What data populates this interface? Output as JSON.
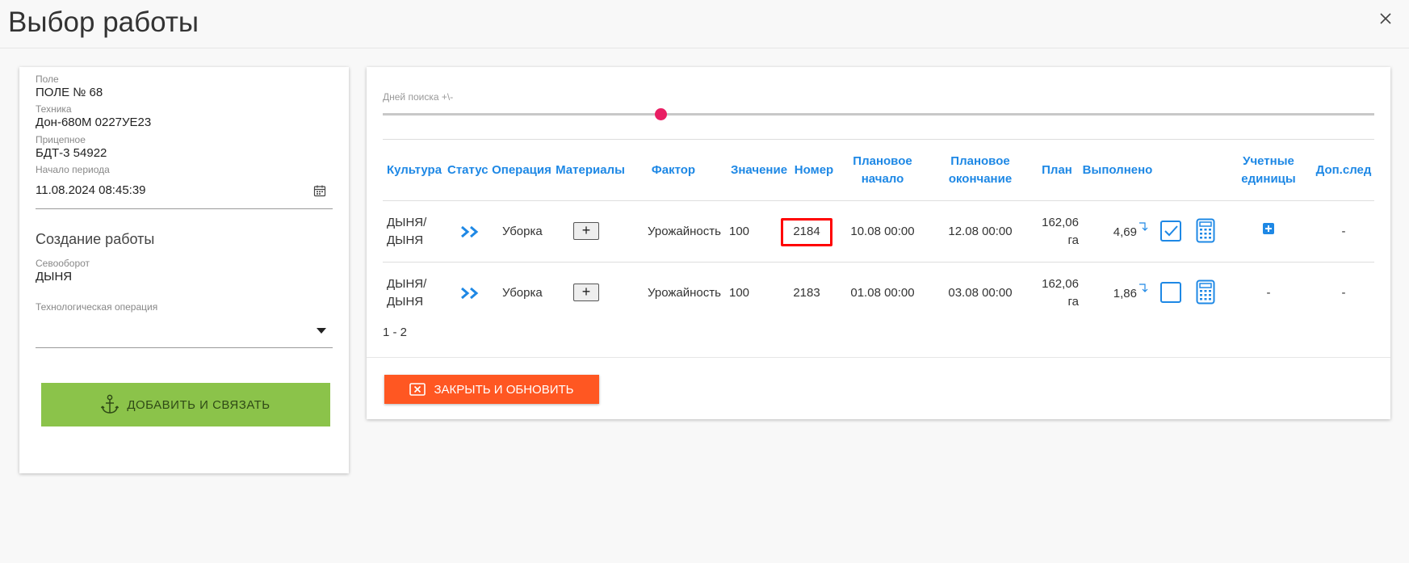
{
  "dialog": {
    "title": "Выбор работы"
  },
  "left": {
    "field_label": "Поле",
    "field_value": "ПОЛЕ № 68",
    "machine_label": "Техника",
    "machine_value": "Дон-680М 0227УЕ23",
    "trailer_label": "Прицепное",
    "trailer_value": "БДТ-3 54922",
    "period_label": "Начало периода",
    "period_value": "11.08.2024 08:45:39",
    "create_title": "Создание работы",
    "rotation_label": "Севооборот",
    "rotation_value": "ДЫНЯ",
    "techop_label": "Технологическая операция",
    "add_button": "ДОБАВИТЬ И СВЯЗАТЬ"
  },
  "right": {
    "slider_label": "Дней поиска +\\-",
    "slider_value_fraction": 0.28,
    "columns": [
      "Культура",
      "Статус",
      "Операция",
      "Материалы",
      "Фактор",
      "Значение",
      "Номер",
      "Плановое начало",
      "Плановое окончание",
      "План",
      "Выполнено",
      "Учетные единицы",
      "Доп.след"
    ],
    "rows": [
      {
        "culture_a": "ДЫНЯ/",
        "culture_b": "ДЫНЯ",
        "operation": "Уборка",
        "factor": "Урожайность",
        "value": "100",
        "number": "2184",
        "plan_start": "10.08 00:00",
        "plan_end": "12.08 00:00",
        "plan_a": "162,06",
        "plan_b": "га",
        "done": "4,69",
        "checked": true,
        "units": "+",
        "extra": "-"
      },
      {
        "culture_a": "ДЫНЯ/",
        "culture_b": "ДЫНЯ",
        "operation": "Уборка",
        "factor": "Урожайность",
        "value": "100",
        "number": "2183",
        "plan_start": "01.08 00:00",
        "plan_end": "03.08 00:00",
        "plan_a": "162,06",
        "plan_b": "га",
        "done": "1,86",
        "checked": false,
        "units": "-",
        "extra": "-"
      }
    ],
    "pager": "1 - 2",
    "close_button": "ЗАКРЫТЬ И ОБНОВИТЬ"
  },
  "colors": {
    "accent": "#1e88e5",
    "green": "#8bc34a",
    "orange": "#ff5722",
    "thumb": "#e91e63",
    "highlight": "#ff0000"
  },
  "icons": [
    "close-icon",
    "calendar-icon",
    "anchor-icon",
    "status-forward-icon",
    "return-arrow-icon",
    "checkbox-icon",
    "calculator-icon",
    "plus-square-icon",
    "close-box-icon"
  ]
}
